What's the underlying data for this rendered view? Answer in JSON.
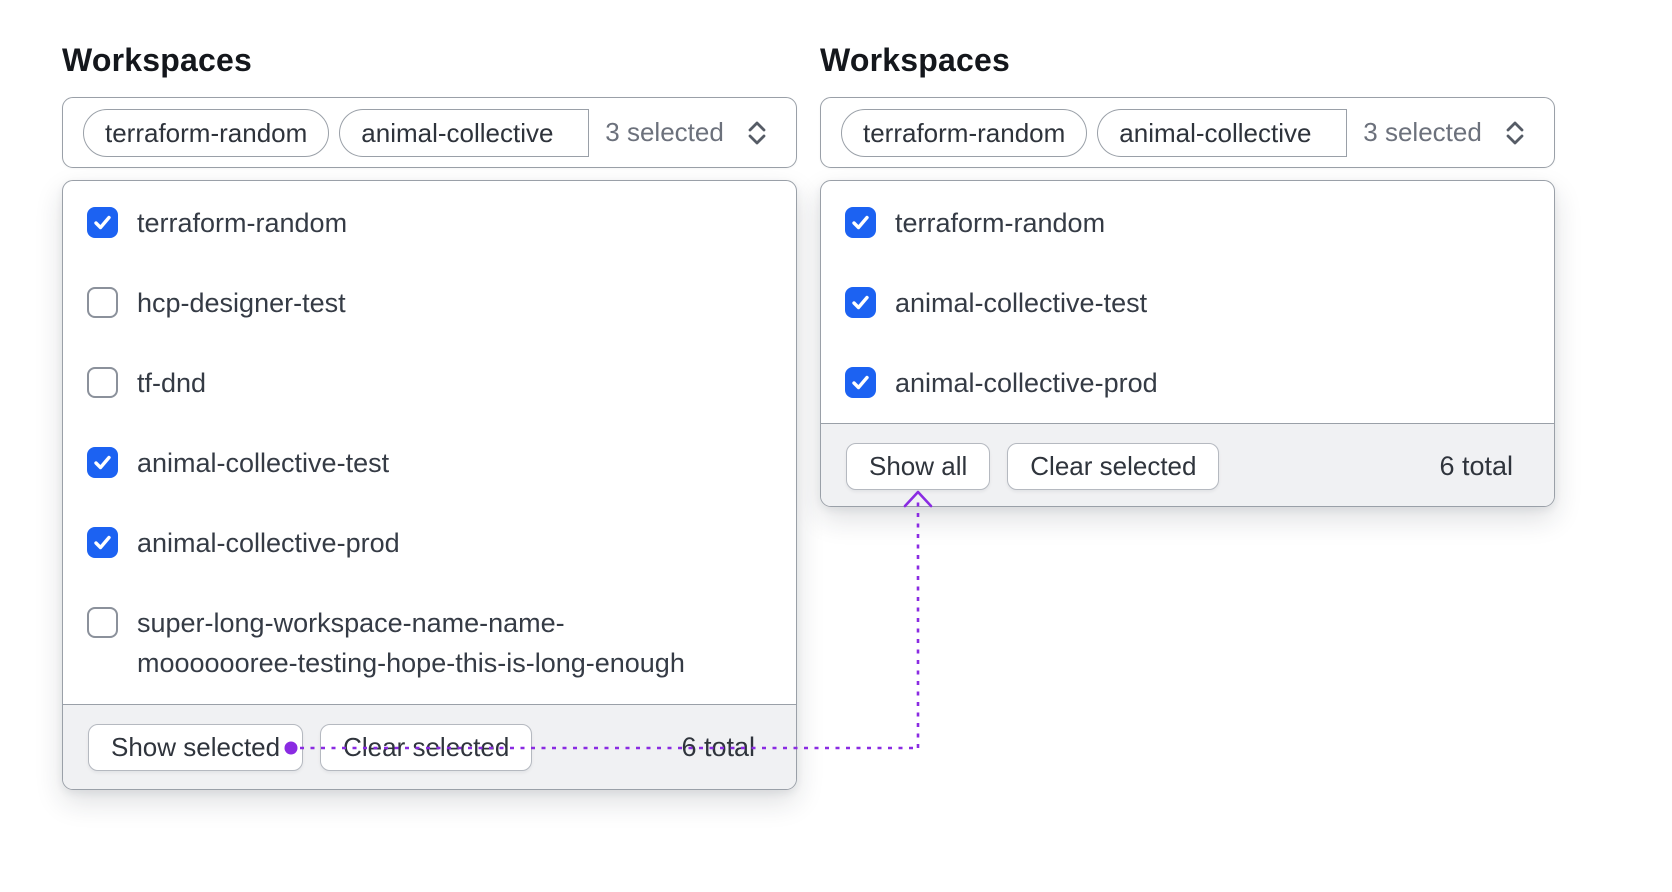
{
  "colors": {
    "checkbox_checked": "#1c62f2",
    "annotation": "#8a2be2"
  },
  "left_panel": {
    "label": "Workspaces",
    "trigger": {
      "chips": [
        {
          "label": "terraform-random",
          "truncated": false
        },
        {
          "label": "animal-collective",
          "truncated": true
        }
      ],
      "summary": "3 selected",
      "icon": "caret-sort-icon"
    },
    "options": [
      {
        "label": "terraform-random",
        "checked": true
      },
      {
        "label": "hcp-designer-test",
        "checked": false
      },
      {
        "label": "tf-dnd",
        "checked": false
      },
      {
        "label": "animal-collective-test",
        "checked": true
      },
      {
        "label": "animal-collective-prod",
        "checked": true
      },
      {
        "label": "super-long-workspace-name-name-mooooooree-testing-hope-this-is-long-enough",
        "checked": false,
        "lines": [
          "super-long-workspace-name-name-",
          "mooooooree-testing-hope-this-is-long-enough"
        ]
      }
    ],
    "footer": {
      "buttons": [
        "Show selected",
        "Clear selected"
      ],
      "total": "6 total"
    }
  },
  "right_panel": {
    "label": "Workspaces",
    "trigger": {
      "chips": [
        {
          "label": "terraform-random",
          "truncated": false
        },
        {
          "label": "animal-collective",
          "truncated": true
        }
      ],
      "summary": "3 selected",
      "icon": "caret-sort-icon"
    },
    "options": [
      {
        "label": "terraform-random",
        "checked": true
      },
      {
        "label": "animal-collective-test",
        "checked": true
      },
      {
        "label": "animal-collective-prod",
        "checked": true
      }
    ],
    "footer": {
      "buttons": [
        "Show all",
        "Clear selected"
      ],
      "total": "6 total"
    }
  }
}
